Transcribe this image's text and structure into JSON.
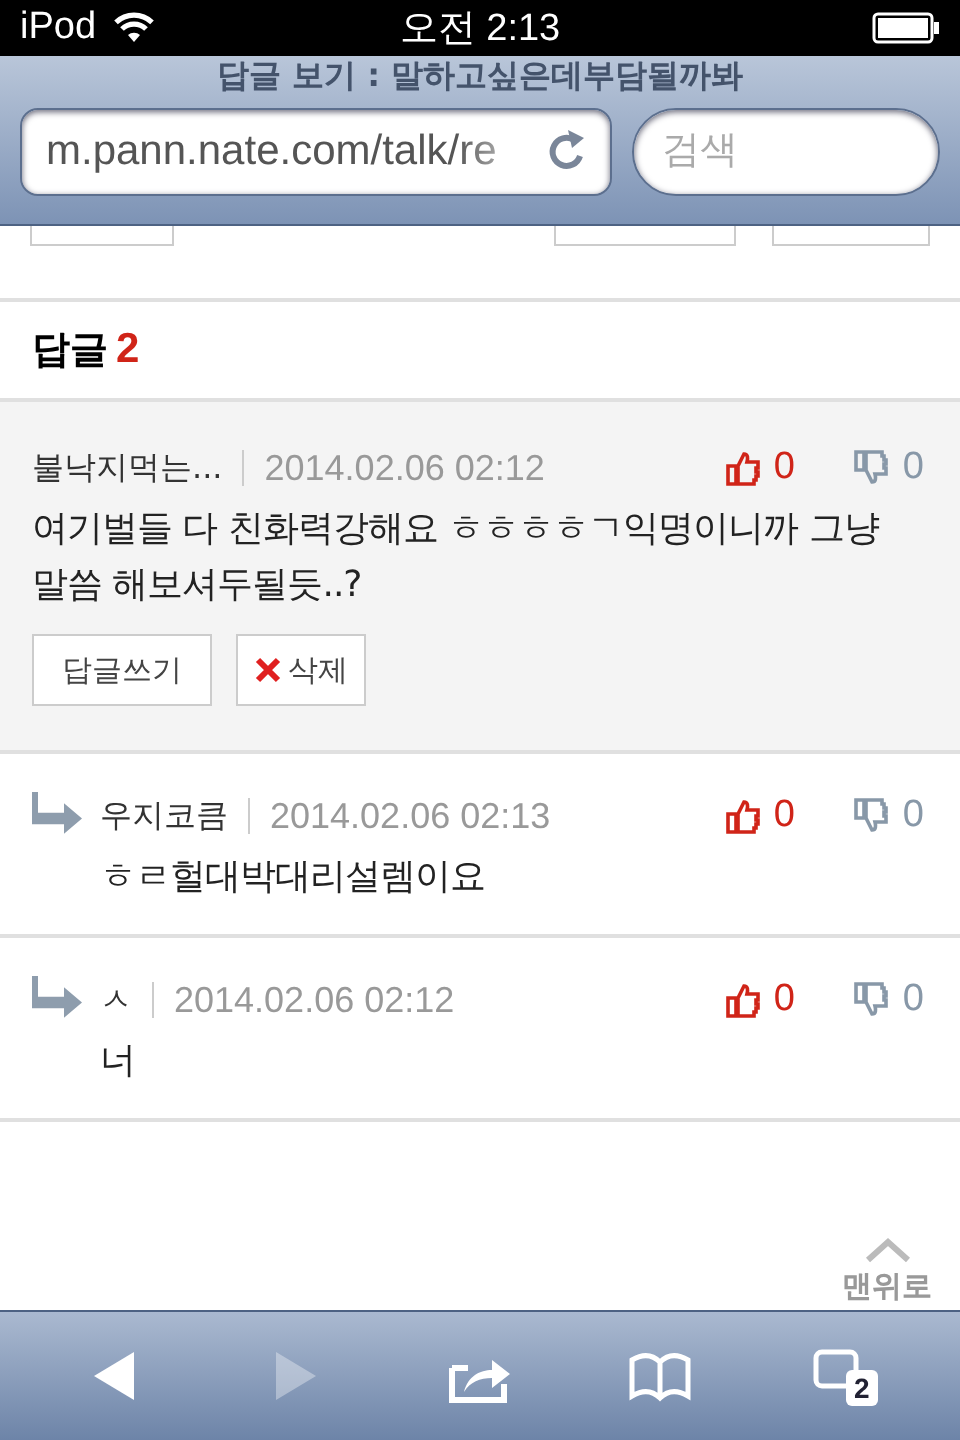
{
  "status_bar": {
    "device": "iPod",
    "time": "오전 2:13"
  },
  "browser": {
    "title": "답글 보기 : 말하고싶은데부담될까봐",
    "url": "m.pann.nate.com/talk/re",
    "search": {
      "placeholder": "검색"
    }
  },
  "replies_header": {
    "label": "답글",
    "count": "2"
  },
  "comments": [
    {
      "kind": "comment",
      "author": "불낙지먹는...",
      "date": "2014.02.06 02:12",
      "likes": "0",
      "dislikes": "0",
      "body": "여기벌들 다 친화력강해요 ㅎㅎㅎㅎㄱ익명이니까 그냥 말씀 해보셔두될듯..?",
      "actions": [
        {
          "kind": "reply",
          "label": "답글쓰기"
        },
        {
          "kind": "delete",
          "label": "삭제"
        }
      ]
    },
    {
      "kind": "reply",
      "author": "우지코큼",
      "date": "2014.02.06 02:13",
      "likes": "0",
      "dislikes": "0",
      "body": "ㅎㄹ헐대박대리설렘이요"
    },
    {
      "kind": "reply",
      "author": "ㅅ",
      "date": "2014.02.06 02:12",
      "likes": "0",
      "dislikes": "0",
      "body": "너"
    }
  ],
  "back_to_top": "맨위로",
  "toolbar": [
    {
      "kind": "back",
      "disabled": false
    },
    {
      "kind": "forward",
      "disabled": true
    },
    {
      "kind": "share",
      "disabled": false
    },
    {
      "kind": "bookmarks",
      "disabled": false
    },
    {
      "kind": "tabs",
      "disabled": false,
      "count": "2"
    }
  ]
}
